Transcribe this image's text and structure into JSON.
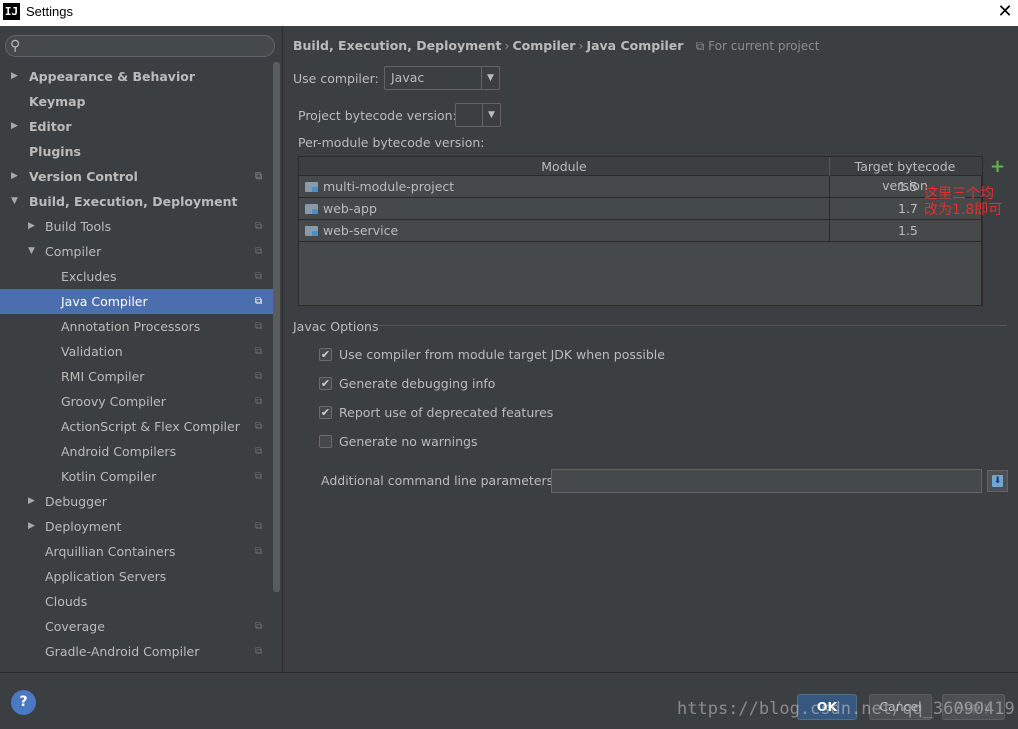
{
  "window": {
    "title": "Settings",
    "app_icon": "IJ"
  },
  "search": {
    "placeholder": ""
  },
  "sidebar": {
    "items": [
      {
        "label": "Appearance & Behavior",
        "arrow": "▶",
        "bold": true,
        "project": false
      },
      {
        "label": "Keymap",
        "arrow": "",
        "bold": true,
        "project": false
      },
      {
        "label": "Editor",
        "arrow": "▶",
        "bold": true,
        "project": false
      },
      {
        "label": "Plugins",
        "arrow": "",
        "bold": true,
        "project": false
      },
      {
        "label": "Version Control",
        "arrow": "▶",
        "bold": true,
        "project": true
      },
      {
        "label": "Build, Execution, Deployment",
        "arrow": "▼",
        "bold": true,
        "project": false
      },
      {
        "label": "Build Tools",
        "arrow": "▶",
        "bold": false,
        "project": true
      },
      {
        "label": "Compiler",
        "arrow": "▼",
        "bold": false,
        "project": true
      },
      {
        "label": "Excludes",
        "arrow": "",
        "bold": false,
        "project": true
      },
      {
        "label": "Java Compiler",
        "arrow": "",
        "bold": false,
        "project": true,
        "selected": true
      },
      {
        "label": "Annotation Processors",
        "arrow": "",
        "bold": false,
        "project": true
      },
      {
        "label": "Validation",
        "arrow": "",
        "bold": false,
        "project": true
      },
      {
        "label": "RMI Compiler",
        "arrow": "",
        "bold": false,
        "project": true
      },
      {
        "label": "Groovy Compiler",
        "arrow": "",
        "bold": false,
        "project": true
      },
      {
        "label": "ActionScript & Flex Compiler",
        "arrow": "",
        "bold": false,
        "project": true
      },
      {
        "label": "Android Compilers",
        "arrow": "",
        "bold": false,
        "project": true
      },
      {
        "label": "Kotlin Compiler",
        "arrow": "",
        "bold": false,
        "project": true
      },
      {
        "label": "Debugger",
        "arrow": "▶",
        "bold": false,
        "project": false
      },
      {
        "label": "Deployment",
        "arrow": "▶",
        "bold": false,
        "project": true
      },
      {
        "label": "Arquillian Containers",
        "arrow": "",
        "bold": false,
        "project": true
      },
      {
        "label": "Application Servers",
        "arrow": "",
        "bold": false,
        "project": false
      },
      {
        "label": "Clouds",
        "arrow": "",
        "bold": false,
        "project": false
      },
      {
        "label": "Coverage",
        "arrow": "",
        "bold": false,
        "project": true
      },
      {
        "label": "Gradle-Android Compiler",
        "arrow": "",
        "bold": false,
        "project": true
      }
    ]
  },
  "breadcrumb": {
    "parts": [
      "Build, Execution, Deployment",
      "Compiler",
      "Java Compiler"
    ],
    "separator": "›",
    "scope": "For current project"
  },
  "compiler": {
    "use_compiler_label": "Use compiler:",
    "use_compiler_value": "Javac",
    "project_bytecode_label": "Project bytecode version:",
    "project_bytecode_value": "",
    "per_module_label": "Per-module bytecode version:"
  },
  "module_table": {
    "headers": [
      "Module",
      "Target bytecode version"
    ],
    "rows": [
      {
        "module": "multi-module-project",
        "version": "1.5"
      },
      {
        "module": "web-app",
        "version": "1.7"
      },
      {
        "module": "web-service",
        "version": "1.5"
      }
    ],
    "add_icon": "+"
  },
  "annotation": {
    "line1": "这里三个均",
    "line2": "改为1.8即可",
    "color": "#e03030"
  },
  "javac_options": {
    "title": "Javac Options",
    "options": [
      {
        "label": "Use compiler from module target JDK when possible",
        "checked": true
      },
      {
        "label": "Generate debugging info",
        "checked": true
      },
      {
        "label": "Report use of deprecated features",
        "checked": true
      },
      {
        "label": "Generate no warnings",
        "checked": false
      }
    ],
    "additional_params_label": "Additional command line parameters:",
    "additional_params_value": ""
  },
  "footer": {
    "help": "?",
    "ok": "OK",
    "cancel": "Cancel",
    "apply": "Apply",
    "watermark": "https://blog.csdn.net/qq_36090419"
  },
  "colors": {
    "background": "#3c3f41",
    "selection": "#4b6eaf",
    "ok_button": "#365880",
    "add_icon": "#5fb54f"
  }
}
